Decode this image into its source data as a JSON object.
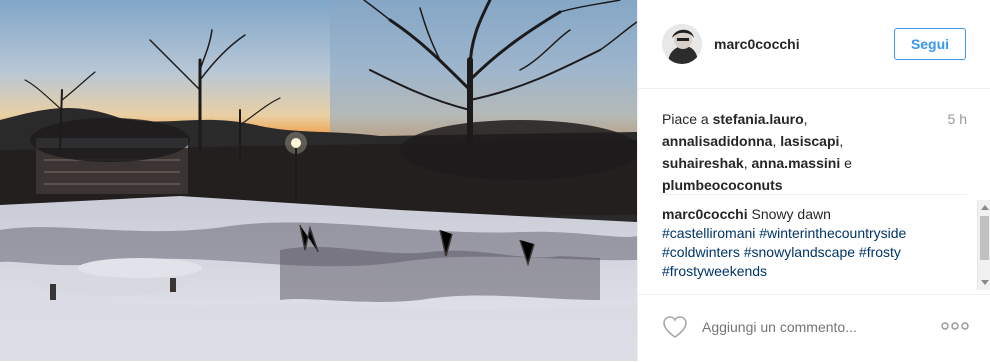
{
  "post": {
    "username": "marc0cocchi",
    "follow_label": "Segui",
    "time_ago": "5 h",
    "likes": {
      "prefix": "Piace a ",
      "users": [
        "stefania.lauro",
        "annalisadidonna",
        "lasiscapi",
        "suhaireshak",
        "anna.massini",
        "plumbeococonuts"
      ],
      "separator": ", ",
      "conjunction": " e "
    },
    "caption": {
      "author": "marc0cocchi",
      "text": " Snowy dawn ",
      "hashtags": [
        "#castelliromani",
        "#winterinthecountryside",
        "#coldwinters",
        "#snowylandscape",
        "#frosty",
        "#frostyweekends"
      ]
    },
    "comment_placeholder": "Aggiungi un commento...",
    "icons": {
      "like": "heart-outline-icon",
      "more": "more-options-icon"
    }
  }
}
